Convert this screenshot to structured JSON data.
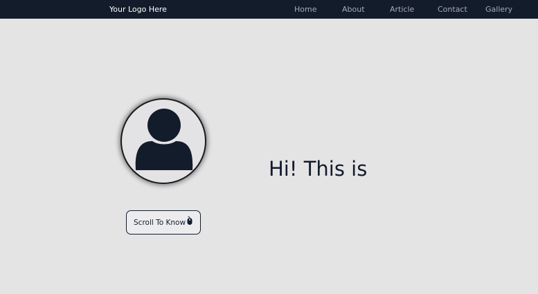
{
  "navbar": {
    "logo": "Your Logo Here",
    "links": [
      {
        "label": "Home"
      },
      {
        "label": "About"
      },
      {
        "label": "Article"
      },
      {
        "label": "Contact"
      },
      {
        "label": "Gallery"
      }
    ]
  },
  "hero": {
    "title": "Hi! This is",
    "scroll_button_label": "Scroll To Know"
  },
  "icons": {
    "avatar": "user-silhouette-icon",
    "scroll": "mouse-icon"
  },
  "colors": {
    "navbar_bg": "#131c2b",
    "page_bg": "#e5e4e5",
    "nav_link": "#a7abb3",
    "text_dark": "#131c2b"
  }
}
